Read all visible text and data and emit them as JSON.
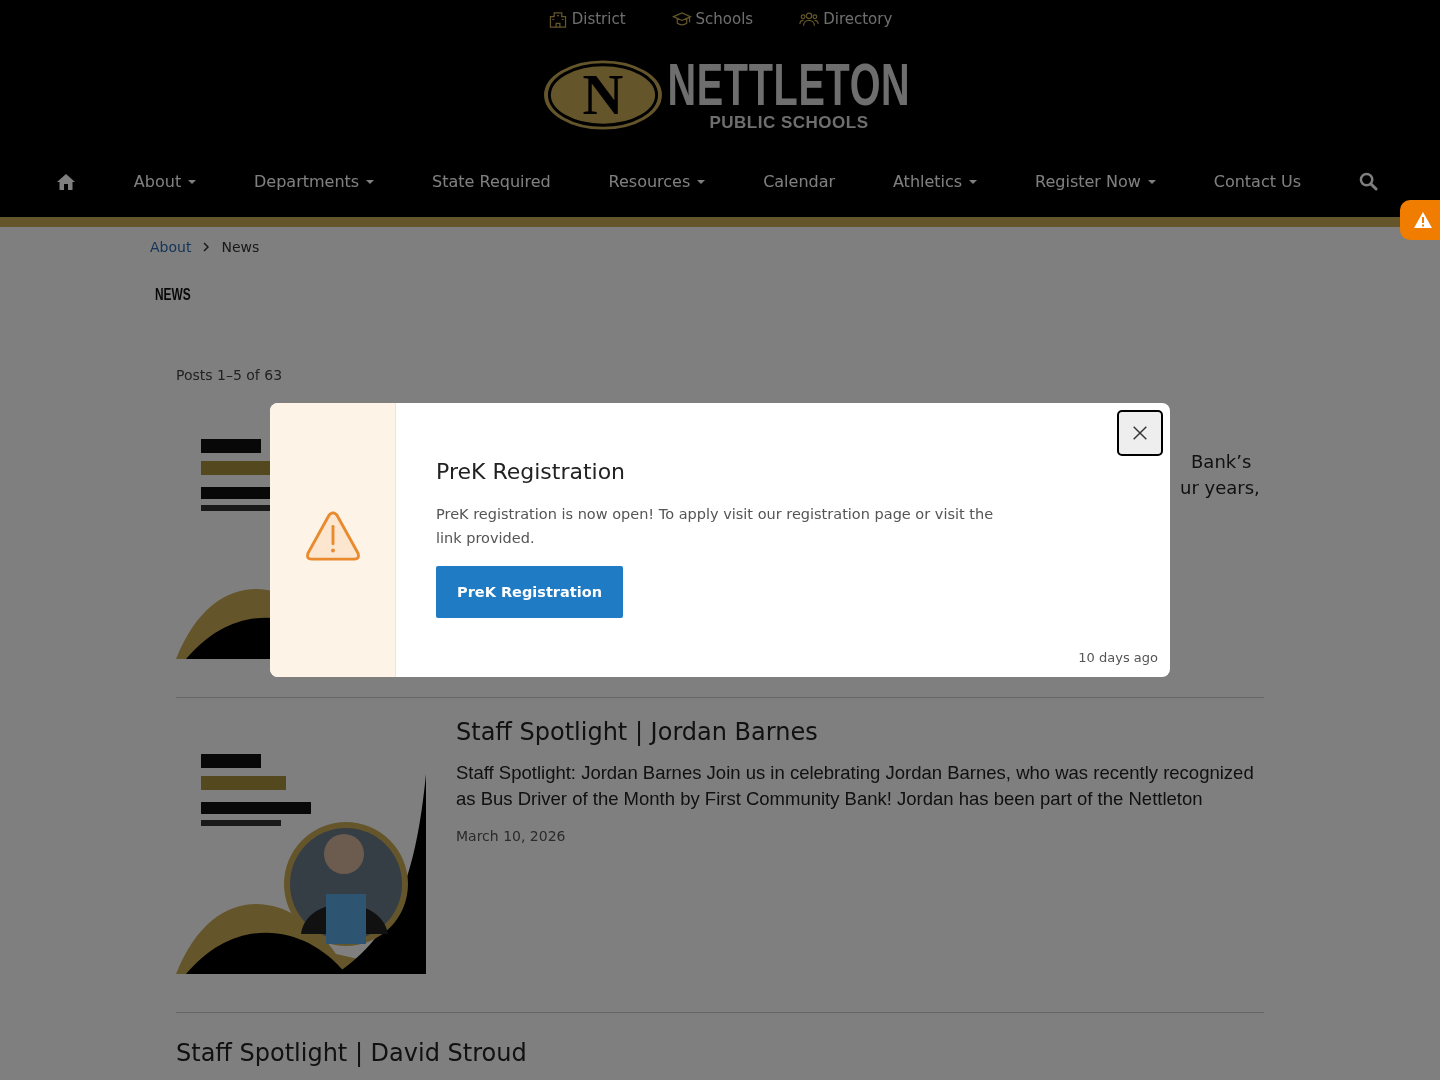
{
  "top_links": [
    {
      "label": "District"
    },
    {
      "label": "Schools"
    },
    {
      "label": "Directory"
    }
  ],
  "logo": {
    "emblem_letter": "N",
    "name": "NETTLETON",
    "subtitle": "PUBLIC SCHOOLS"
  },
  "nav": [
    {
      "label": "About",
      "dropdown": true
    },
    {
      "label": "Departments",
      "dropdown": true
    },
    {
      "label": "State Required",
      "dropdown": false
    },
    {
      "label": "Resources",
      "dropdown": true
    },
    {
      "label": "Calendar",
      "dropdown": false
    },
    {
      "label": "Athletics",
      "dropdown": true
    },
    {
      "label": "Register Now",
      "dropdown": true
    },
    {
      "label": "Contact Us",
      "dropdown": false
    }
  ],
  "breadcrumb": [
    {
      "label": "About",
      "link": true
    },
    {
      "label": "News",
      "link": false
    }
  ],
  "heading": "NEWS",
  "posts_count": "Posts 1–5 of 63",
  "posts": [
    {
      "kind": "partial",
      "excerpt_fragments": [
        "Bank’s",
        "ur years,"
      ]
    },
    {
      "kind": "full",
      "title": "Staff Spotlight | Jordan Barnes",
      "excerpt": "Staff Spotlight: Jordan Barnes Join us in celebrating Jordan Barnes, who was recently recognized as Bus Driver of the Month by First Community Bank! Jordan has been part of the Nettleton",
      "date": "March 10, 2026"
    },
    {
      "kind": "cut",
      "title": "Staff Spotlight | David Stroud"
    }
  ],
  "modal": {
    "title": "PreK Registration",
    "body": "PreK registration is now open! To apply visit our registration page or visit the link provided.",
    "button": "PreK Registration",
    "time": "10 days ago"
  }
}
